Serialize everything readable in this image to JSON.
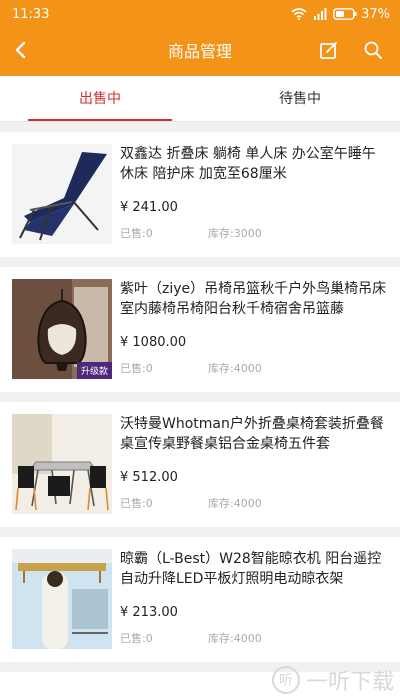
{
  "status_bar": {
    "time": "11:33",
    "battery": "37%"
  },
  "header": {
    "title": "商品管理"
  },
  "tabs": [
    {
      "label": "出售中"
    },
    {
      "label": "待售中"
    }
  ],
  "products": [
    {
      "title": "双鑫达 折叠床 躺椅 单人床 办公室午睡午休床 陪护床 加宽至68厘米",
      "price": "¥ 241.00",
      "sold": "已售:0",
      "stock": "库存:3000",
      "badge": ""
    },
    {
      "title": "紫叶（ziye）吊椅吊篮秋千户外鸟巢椅吊床室内藤椅吊椅阳台秋千椅宿舍吊篮藤",
      "price": "¥ 1080.00",
      "sold": "已售:0",
      "stock": "库存:4000",
      "badge": "升级款"
    },
    {
      "title": "沃特曼Whotman户外折叠桌椅套装折叠餐桌宣传桌野餐桌铝合金桌椅五件套",
      "price": "¥ 512.00",
      "sold": "已售:0",
      "stock": "库存:4000",
      "badge": ""
    },
    {
      "title": "晾霸（L-Best）W28智能晾衣机 阳台遥控自动升降LED平板灯照明电动晾衣架",
      "price": "¥ 213.00",
      "sold": "已售:0",
      "stock": "库存:4000",
      "badge": ""
    }
  ],
  "watermark": {
    "text": "一听下载",
    "logo": "听"
  },
  "colors": {
    "accent": "#f39318",
    "active_tab": "#d32f2f"
  },
  "icons": {
    "back": "back-arrow-icon",
    "edit": "edit-icon",
    "search": "search-icon",
    "wifi": "wifi-icon",
    "signal": "signal-icon",
    "battery": "battery-icon"
  }
}
